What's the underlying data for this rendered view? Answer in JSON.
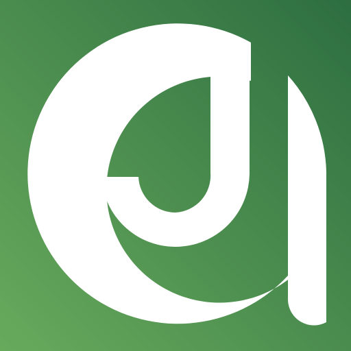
{
  "icon": {
    "name": "logo-icon",
    "description_colors": {
      "gradient_top_right": "#2d6e41",
      "gradient_bottom_left": "#68aa5c",
      "glyph": "#ffffff"
    }
  }
}
